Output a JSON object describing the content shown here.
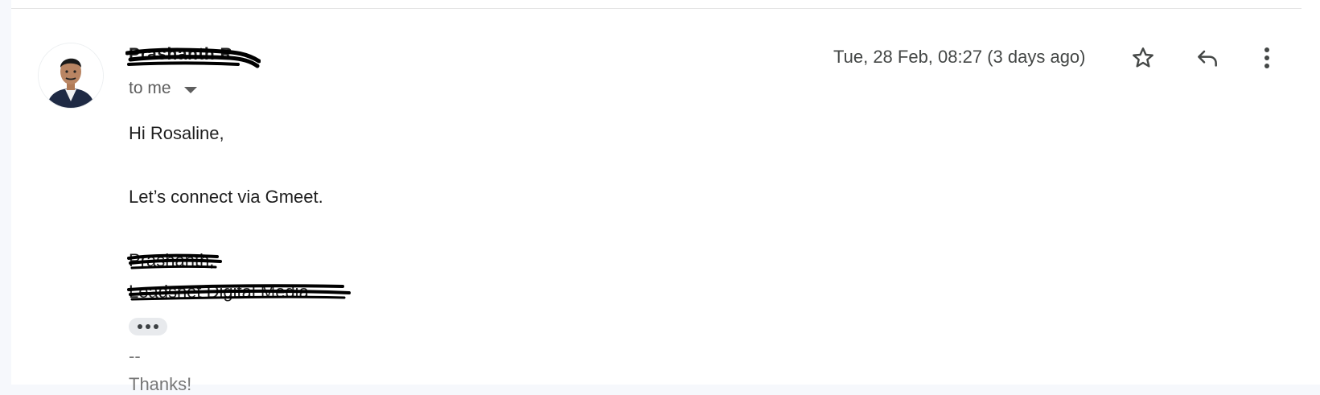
{
  "message": {
    "sender_name": "Prashanth R",
    "recipient_label": "to me",
    "date": "Tue, 28 Feb, 08:27 (3 days ago)",
    "greeting": "Hi Rosaline,",
    "body": "Let’s connect via Gmeet.",
    "signature_name": "Prashanth,",
    "signature_company": "Leadsnet Digital Media",
    "separator": "--",
    "closing": "Thanks!"
  },
  "icons": {
    "star": "star-icon",
    "reply": "reply-icon",
    "more": "more-vert-icon",
    "caret": "caret-down-icon",
    "ellipsis": "ellipsis-icon"
  },
  "colors": {
    "text_primary": "#1f1f1f",
    "text_secondary": "#5e5e5e",
    "redaction": "#000000"
  }
}
